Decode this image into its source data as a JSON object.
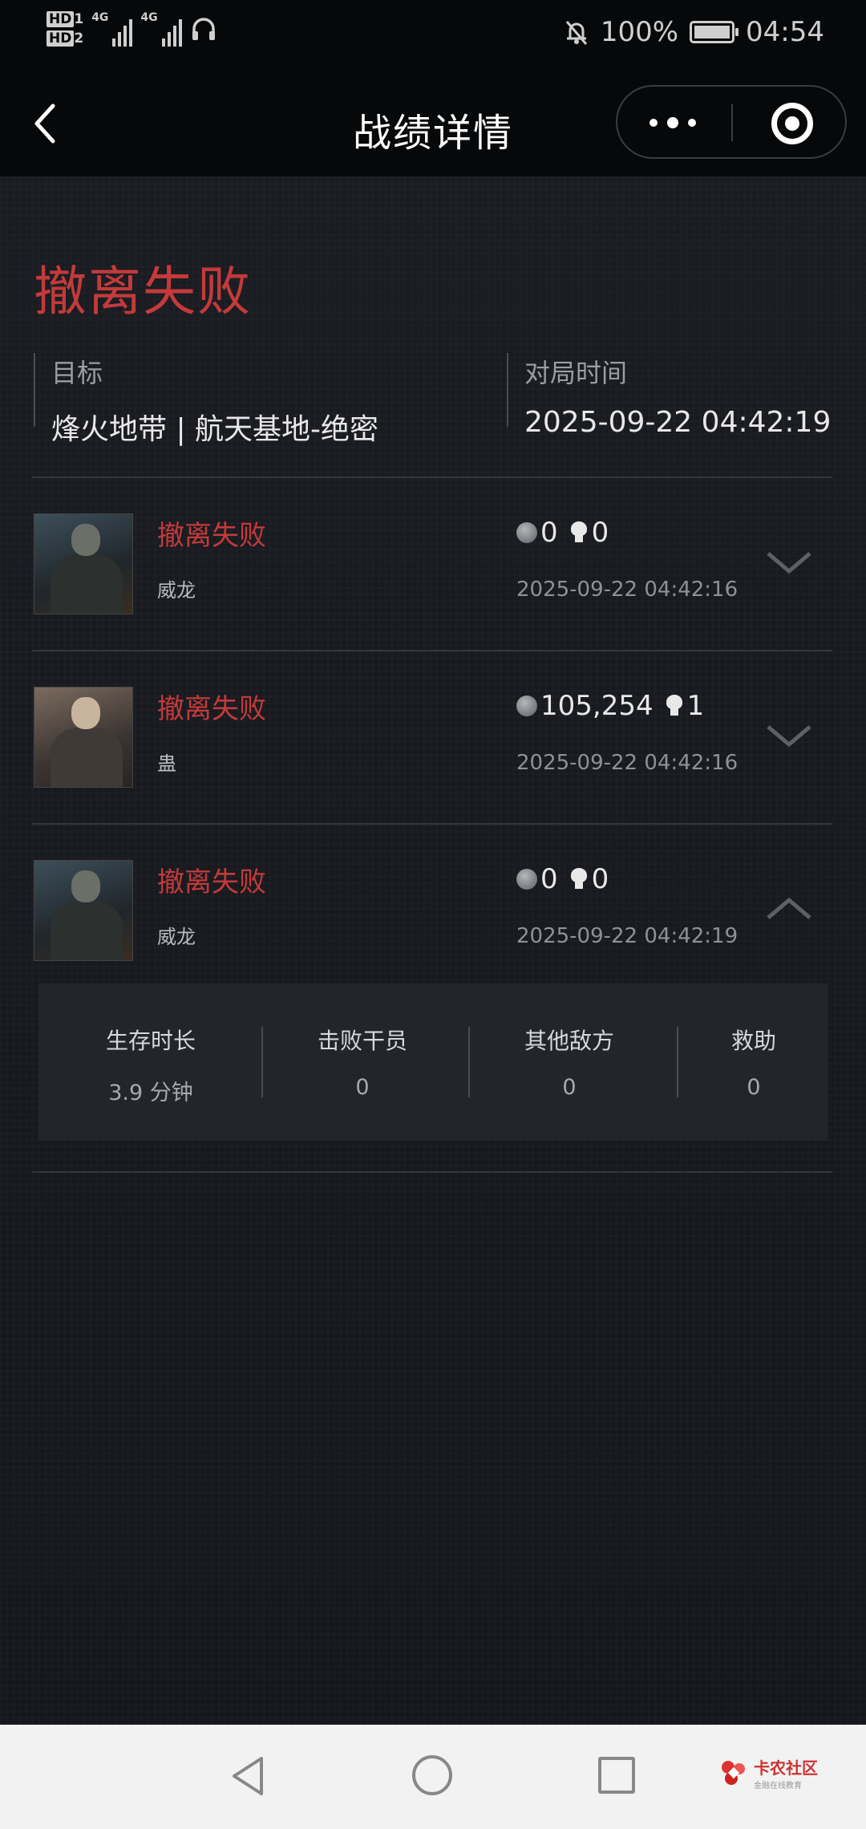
{
  "status_bar": {
    "hd1": "HD",
    "hd1_sub": "1",
    "hd2": "HD",
    "hd2_sub": "2",
    "net1": "4G",
    "net2": "4G",
    "battery": "100%",
    "battery_level": 1.0,
    "time": "04:54"
  },
  "header": {
    "title": "战绩详情"
  },
  "summary": {
    "result": "撤离失败",
    "target_label": "目标",
    "target_value": "烽火地带 | 航天基地-绝密",
    "time_label": "对局时间",
    "time_value": "2025-09-22 04:42:19"
  },
  "players": [
    {
      "status": "撤离失败",
      "name": "威龙",
      "money": "0",
      "kills": "0",
      "time": "2025-09-22 04:42:16",
      "expanded": false,
      "avatar": "male-soldier"
    },
    {
      "status": "撤离失败",
      "name": "蛊",
      "money": "105,254",
      "kills": "1",
      "time": "2025-09-22 04:42:16",
      "expanded": false,
      "avatar": "female-soldier"
    },
    {
      "status": "撤离失败",
      "name": "威龙",
      "money": "0",
      "kills": "0",
      "time": "2025-09-22 04:42:19",
      "expanded": true,
      "avatar": "male-soldier"
    }
  ],
  "detail": {
    "items": [
      {
        "label": "生存时长",
        "value": "3.9 分钟"
      },
      {
        "label": "击败干员",
        "value": "0"
      },
      {
        "label": "其他敌方",
        "value": "0"
      },
      {
        "label": "救助",
        "value": "0"
      }
    ]
  },
  "logo": {
    "main": "卡农社区",
    "sub": "金融在线教育"
  },
  "colors": {
    "accent_red": "#c43a3a",
    "background": "#14161b"
  },
  "icons": [
    "back-arrow-icon",
    "more-dots-icon",
    "close-target-icon",
    "coin-icon",
    "skull-icon",
    "chevron-down-icon",
    "chevron-up-icon",
    "nav-back-icon",
    "nav-home-icon",
    "nav-recent-icon"
  ]
}
